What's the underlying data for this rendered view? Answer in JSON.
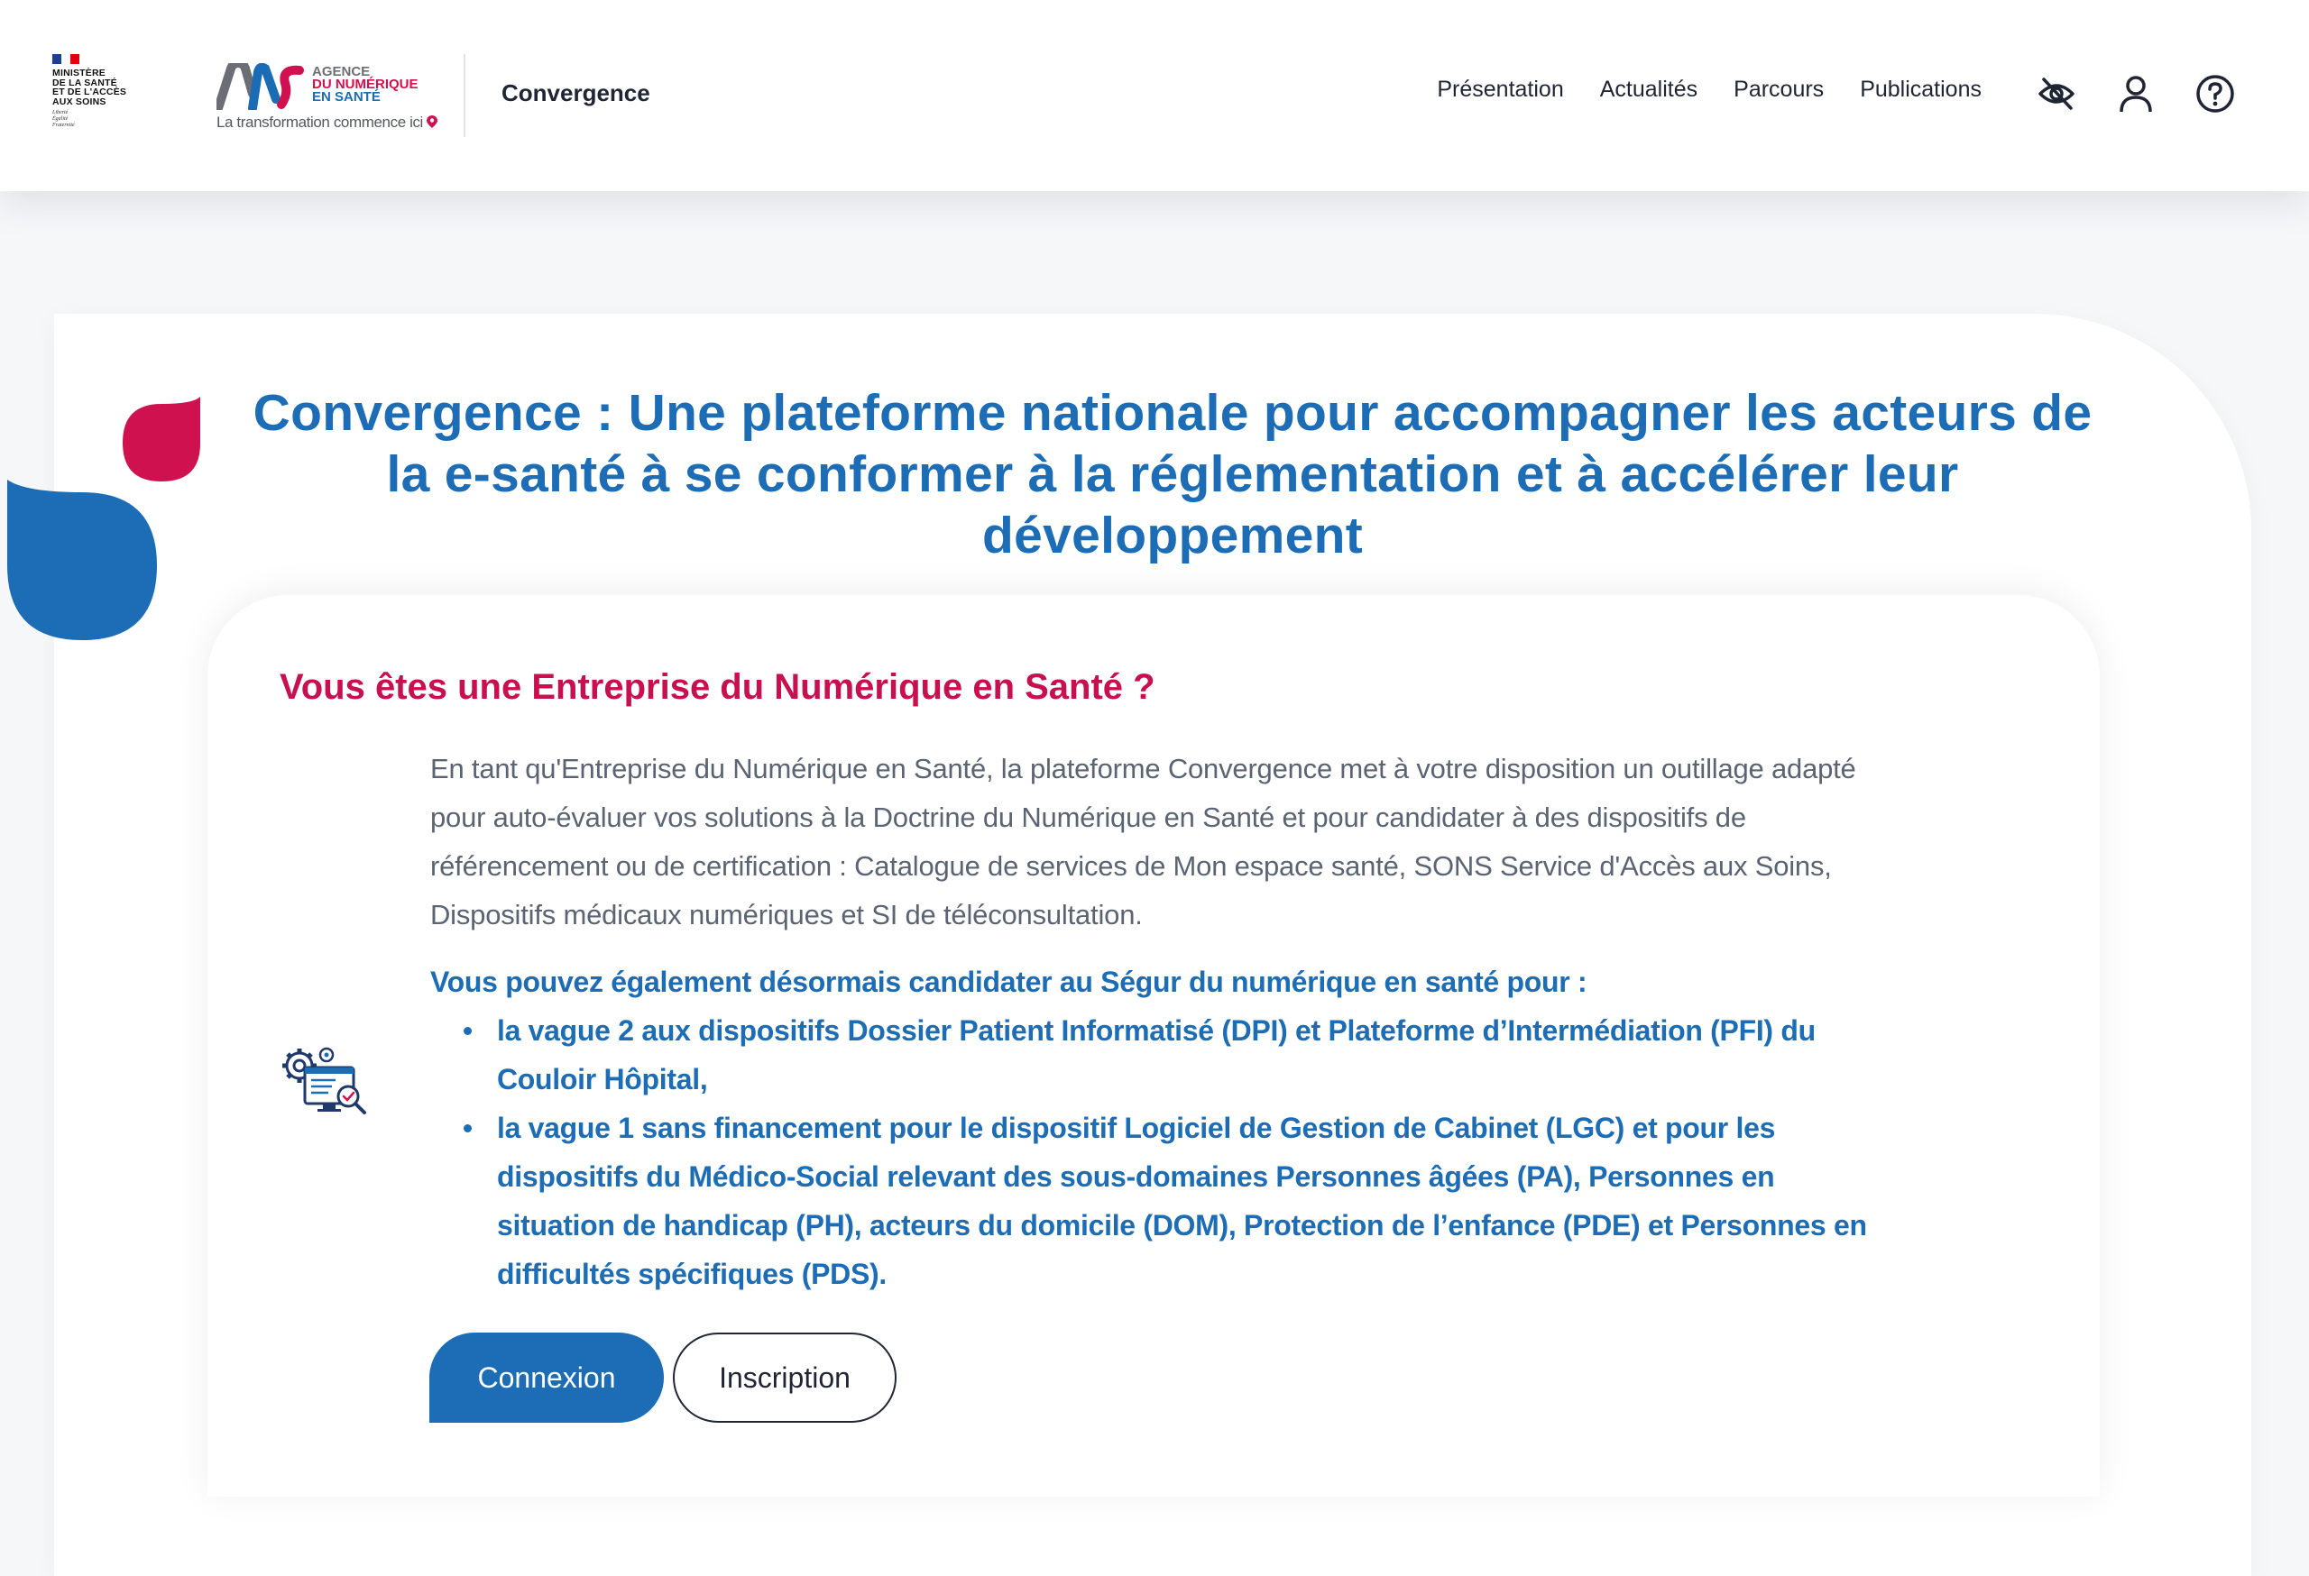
{
  "header": {
    "gov_logo": {
      "lines": [
        "MINISTÈRE",
        "DE LA SANTÉ",
        "ET DE L'ACCÈS",
        "AUX SOINS"
      ],
      "motto": [
        "Liberté",
        "Égalité",
        "Fraternité"
      ]
    },
    "ans_logo": {
      "word1": "AGENCE",
      "word2": "DU NUMÉRIQUE",
      "word3": "EN SANTÉ",
      "tagline": "La transformation commence ici"
    },
    "brand": "Convergence",
    "nav": [
      {
        "label": "Présentation"
      },
      {
        "label": "Actualités"
      },
      {
        "label": "Parcours"
      },
      {
        "label": "Publications"
      }
    ],
    "icons": [
      "eye-slash-icon",
      "user-icon",
      "help-circle-icon"
    ]
  },
  "main": {
    "title": "Convergence : Une plateforme nationale pour accompagner les acteurs de la e-santé à se conformer à la réglementation et à accélérer leur développement",
    "card": {
      "heading": "Vous êtes une Entreprise du Numérique en Santé ?",
      "icon": "settings-screen-search-icon",
      "description": "En tant qu'Entreprise du Numérique en Santé, la plateforme Convergence met à votre disposition un outillage adapté pour auto-évaluer vos solutions à la Doctrine du Numérique en Santé et pour candidater à des dispositifs de référencement ou de certification : Catalogue de services de Mon espace santé, SONS Service d'Accès aux Soins, Dispositifs médicaux numériques et SI de téléconsultation.",
      "segur_lead": "Vous pouvez également désormais candidater au Ségur du numérique en santé pour :",
      "segur_items": [
        "la vague 2 aux dispositifs Dossier Patient Informatisé (DPI) et Plateforme d’Intermédiation (PFI) du Couloir Hôpital,",
        "la vague 1 sans financement pour le dispositif Logiciel de Gestion de Cabinet (LGC) et pour les dispositifs du Médico-Social relevant des sous-domaines Personnes âgées (PA), Personnes en situation de handicap (PH), acteurs du domicile (DOM), Protection de l’enfance (PDE) et Personnes en difficultés spécifiques (PDS)."
      ],
      "buttons": {
        "login": "Connexion",
        "signup": "Inscription"
      }
    }
  },
  "colors": {
    "primary_blue": "#1c6db5",
    "accent_red": "#c8104f",
    "text_dark": "#1f2533",
    "text_gray": "#5b6472"
  }
}
